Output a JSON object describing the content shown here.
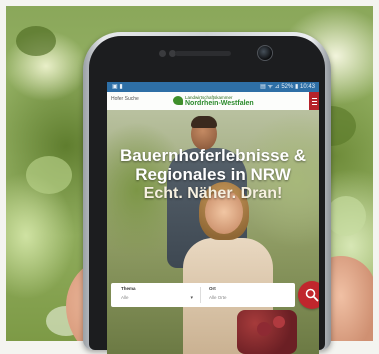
{
  "status_bar": {
    "left_icons": "▣ ▮",
    "right_text": "▤ ᯤ ⊿ 52% ▮ 10:43"
  },
  "site_header": {
    "nav_text": "Hofer Suche",
    "logo_line1": "Landwirtschaftskammer",
    "logo_line2": "Nordrhein-Westfalen",
    "menu_icon": "hamburger-menu-icon"
  },
  "hero": {
    "headline_line1": "Bauernhoferlebnisse &",
    "headline_line2": "Regionales in NRW",
    "headline_line3": "Echt. Näher. Dran!"
  },
  "search": {
    "field1_label": "Thema",
    "field1_value": "Alle",
    "field2_label": "Ort",
    "field2_value": "Alle Orte",
    "button_icon": "search-icon"
  },
  "colors": {
    "accent_red": "#c0262d",
    "status_blue": "#2e6fa6",
    "logo_green": "#2b8a2b"
  }
}
